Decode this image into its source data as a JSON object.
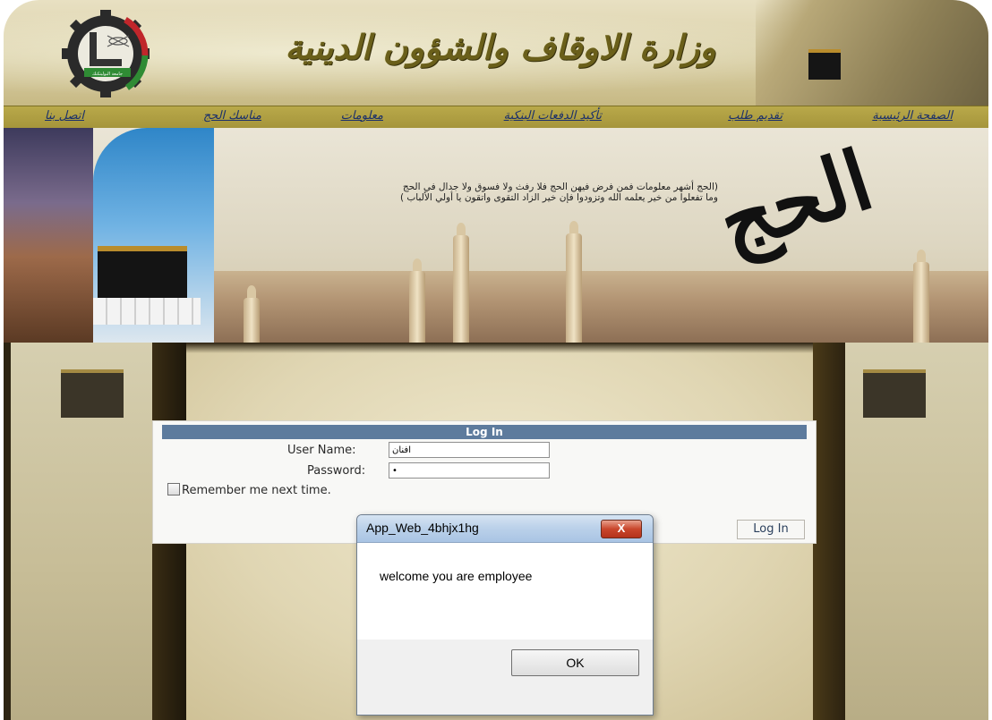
{
  "header": {
    "title": "وزارة الاوقاف والشؤون الدينية",
    "logo_text": "جامعة البوليتكنك"
  },
  "nav": {
    "items": [
      {
        "label": "الصفحة الرئيسية"
      },
      {
        "label": "تقديم طلب"
      },
      {
        "label": "تأكيد الدفعات البنكية"
      },
      {
        "label": "معلومات"
      },
      {
        "label": "مناسك الحج"
      },
      {
        "label": "اتصل بنا"
      }
    ]
  },
  "banner": {
    "verse_line1": "(الحج أشهر معلومات فمن فرض فيهن الحج فلا رفث ولا فسوق ولا جدال في الحج",
    "verse_line2": "وما تفعلوا من خير يعلمه الله وتزودوا فإن خير الزاد التقوى واتقون يا أولي الألباب )",
    "calligraphy": "الحج"
  },
  "login": {
    "header": "Log In",
    "username_label": "User Name:",
    "username_value": "افنان",
    "password_label": "Password:",
    "password_value": "•",
    "remember_label": "Remember me next time.",
    "button_label": "Log In"
  },
  "dialog": {
    "title": "App_Web_4bhjx1hg",
    "close_label": "X",
    "message": "welcome you are employee",
    "ok_label": "OK"
  },
  "colors": {
    "login_header_bg": "#5d7b9d",
    "nav_bg": "#a5953b",
    "nav_link": "#1a2f6b",
    "close_button": "#c9462c"
  }
}
